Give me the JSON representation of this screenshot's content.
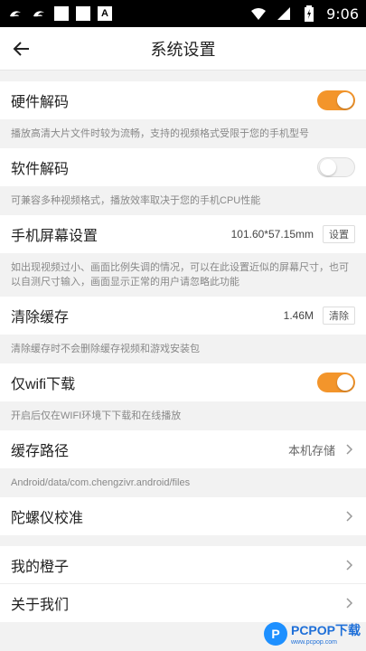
{
  "statusbar": {
    "time": "9:06",
    "icons": [
      "uc-icon",
      "uc-icon",
      "square-icon",
      "square-icon",
      "a-icon",
      "wifi-icon",
      "signal-icon",
      "battery-icon"
    ]
  },
  "appbar": {
    "title": "系统设置"
  },
  "settings": {
    "hardware_decode": {
      "label": "硬件解码",
      "enabled": true,
      "desc": "播放高清大片文件时较为流畅，支持的视频格式受限于您的手机型号"
    },
    "software_decode": {
      "label": "软件解码",
      "enabled": false,
      "desc": "可兼容多种视频格式，播放效率取决于您的手机CPU性能"
    },
    "screen_settings": {
      "label": "手机屏幕设置",
      "value": "101.60*57.15mm",
      "button": "设置",
      "desc": "如出现视频过小、画面比例失调的情况，可以在此设置近似的屏幕尺寸，也可以自测尺寸输入，画面显示正常的用户请忽略此功能"
    },
    "clear_cache": {
      "label": "清除缓存",
      "value": "1.46M",
      "button": "清除",
      "desc": "清除缓存时不会删除缓存视频和游戏安装包"
    },
    "wifi_only": {
      "label": "仅wifi下载",
      "enabled": true,
      "desc": "开启后仅在WIFI环境下下载和在线播放"
    },
    "cache_path": {
      "label": "缓存路径",
      "value": "本机存储",
      "desc": "Android/data/com.chengzivr.android/files"
    },
    "gyro_calibrate": {
      "label": "陀螺仪校准"
    },
    "my_orange": {
      "label": "我的橙子"
    },
    "about_us": {
      "label": "关于我们"
    }
  },
  "watermark": {
    "logo": "P",
    "brand": "PCPOP下载",
    "sub": "www.pcpop.com"
  },
  "colors": {
    "accent": "#f3952b",
    "background": "#f2f2f2"
  }
}
